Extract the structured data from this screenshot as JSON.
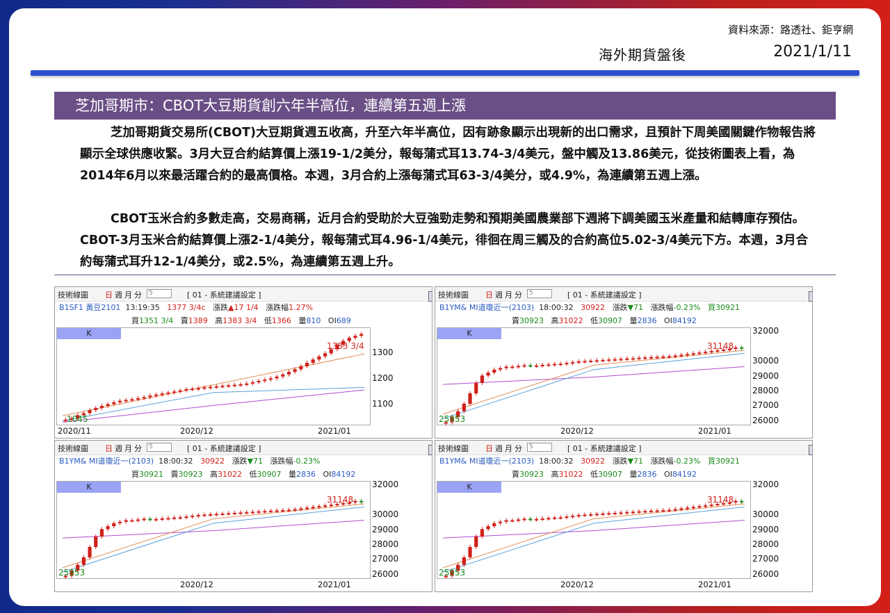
{
  "header": {
    "source": "資料來源：路透社、鉅亨網",
    "section": "海外期貨盤後",
    "date": "2021/1/11"
  },
  "article": {
    "title": "芝加哥期市：CBOT大豆期貨創六年半高位，連續第五週上漲",
    "paragraphs": [
      "芝加哥期貨交易所(CBOT)大豆期貨週五收高，升至六年半高位，因有跡象顯示出現新的出口需求，且預計下周美國關鍵作物報告將顯示全球供應收緊。3月大豆合約結算價上漲19-1/2美分，報每蒲式耳13.74-3/4美元，盤中觸及13.86美元，從技術圖表上看，為2014年6月以來最活躍合約的最高價格。本週，3月合約上漲每蒲式耳63-3/4美分，或4.9%，為連續第五週上漲。",
      "CBOT玉米合約多數走高，交易商稱，近月合約受助於大豆強勁走勢和預期美國農業部下週將下調美國玉米產量和結轉庫存預估。CBOT-3月玉米合約結算價上漲2-1/4美分，報每蒲式耳4.96-1/4美元，徘徊在周三觸及的合約高位5.02-3/4美元下方。本週，3月合約每蒲式耳升12-1/4美分，或2.5%，為連續第五週上升。"
    ]
  },
  "toolbar": {
    "label": "技術線圖",
    "day": "日",
    "week": "週",
    "month": "月",
    "minute": "分",
    "period": "5",
    "setting": "[ 01 - 系統建議設定 ]",
    "k_label": "K"
  },
  "chart_data": [
    {
      "type": "candlestick",
      "symbol": "B1SF1 黃豆2101",
      "time": "13:19:35",
      "last": "1377 3/4c",
      "change_label": "漲跌",
      "change": "▲17 1/4",
      "pct_label": "漲跌幅",
      "pct": "1.27%",
      "quote_extra": "",
      "stats": [
        {
          "label": "買",
          "value": "1351 3/4",
          "tone": "green"
        },
        {
          "label": "賣",
          "value": "1389",
          "tone": "red"
        },
        {
          "label": "高",
          "value": "1383 3/4",
          "tone": "red"
        },
        {
          "label": "低",
          "value": "1366",
          "tone": "red"
        },
        {
          "label": "量",
          "value": "810",
          "tone": "blue"
        },
        {
          "label": "OI",
          "value": "689",
          "tone": "blue"
        }
      ],
      "yticks": [
        1300,
        1200,
        1100
      ],
      "ylim": [
        1020,
        1400
      ],
      "high_label": "1383 3/4",
      "low_label": "1045",
      "x_labels": [
        "2020/11",
        "2020/12",
        "2021/01"
      ],
      "closes": [
        1045,
        1050,
        1062,
        1070,
        1082,
        1090,
        1098,
        1105,
        1112,
        1118,
        1121,
        1124,
        1128,
        1132,
        1138,
        1142,
        1146,
        1150,
        1154,
        1158,
        1163,
        1165,
        1167,
        1170,
        1172,
        1174,
        1176,
        1178,
        1180,
        1182,
        1185,
        1190,
        1195,
        1200,
        1205,
        1212,
        1220,
        1230,
        1240,
        1252,
        1265,
        1278,
        1290,
        1302,
        1318,
        1335,
        1350,
        1362,
        1370,
        1377
      ],
      "ma_short": [
        1060,
        1180,
        1300
      ],
      "ma_long": [
        1040,
        1150,
        1170
      ],
      "ma_slow": [
        1035,
        1100,
        1160
      ]
    },
    {
      "type": "candlestick",
      "symbol": "B1YM& MI道瓊近一(2103)",
      "time": "18:00:32",
      "last": "30922",
      "change_label": "漲跌",
      "change": "▼71",
      "pct_label": "漲跌幅",
      "pct": "-0.23%",
      "quote_extra": "買30921",
      "stats": [
        {
          "label": "賣",
          "value": "30923",
          "tone": "green"
        },
        {
          "label": "高",
          "value": "31022",
          "tone": "red"
        },
        {
          "label": "低",
          "value": "30907",
          "tone": "green"
        },
        {
          "label": "量",
          "value": "2836",
          "tone": "blue"
        },
        {
          "label": "OI",
          "value": "84192",
          "tone": "blue"
        }
      ],
      "yticks": [
        32000,
        30000,
        29000,
        28000,
        27000,
        26000
      ],
      "ylim": [
        25700,
        32300
      ],
      "high_label": "31148",
      "low_label": "25953",
      "x_labels": [
        "",
        "2020/12",
        "2021/01"
      ],
      "closes": [
        25953,
        26300,
        26700,
        27200,
        27900,
        28600,
        29100,
        29300,
        29500,
        29600,
        29700,
        29700,
        29750,
        29800,
        29750,
        29780,
        29820,
        29850,
        29880,
        29900,
        29950,
        30000,
        30050,
        30080,
        30100,
        30130,
        30150,
        30180,
        30200,
        30220,
        30250,
        30270,
        30300,
        30320,
        30340,
        30360,
        30380,
        30400,
        30450,
        30500,
        30550,
        30600,
        30650,
        30700,
        30750,
        30800,
        30850,
        30900,
        31000,
        30922
      ],
      "ma_short": [
        26500,
        29800,
        30800
      ],
      "ma_long": [
        26200,
        29500,
        30600
      ],
      "ma_slow": [
        28500,
        29000,
        29700
      ]
    },
    {
      "type": "candlestick",
      "symbol": "B1YM& MI道瓊近一(2103)",
      "time": "18:00:32",
      "last": "30922",
      "change_label": "漲跌",
      "change": "▼71",
      "pct_label": "漲跌幅",
      "pct": "-0.23%",
      "quote_extra": "",
      "stats": [
        {
          "label": "買",
          "value": "30921",
          "tone": "green"
        },
        {
          "label": "賣",
          "value": "30923",
          "tone": "green"
        },
        {
          "label": "高",
          "value": "31022",
          "tone": "red"
        },
        {
          "label": "低",
          "value": "30907",
          "tone": "green"
        },
        {
          "label": "量",
          "value": "2836",
          "tone": "blue"
        },
        {
          "label": "OI",
          "value": "84192",
          "tone": "blue"
        }
      ],
      "yticks": [
        32000,
        30000,
        29000,
        28000,
        27000,
        26000
      ],
      "ylim": [
        25700,
        32300
      ],
      "high_label": "31148",
      "low_label": "25953",
      "x_labels": [
        "",
        "2020/12",
        "2021/01"
      ],
      "closes": [
        25953,
        26300,
        26700,
        27200,
        27900,
        28600,
        29100,
        29300,
        29500,
        29600,
        29700,
        29700,
        29750,
        29800,
        29750,
        29780,
        29820,
        29850,
        29880,
        29900,
        29950,
        30000,
        30050,
        30080,
        30100,
        30130,
        30150,
        30180,
        30200,
        30220,
        30250,
        30270,
        30300,
        30320,
        30340,
        30360,
        30380,
        30400,
        30450,
        30500,
        30550,
        30600,
        30650,
        30700,
        30750,
        30800,
        30850,
        30900,
        31000,
        30922
      ],
      "ma_short": [
        26500,
        29800,
        30800
      ],
      "ma_long": [
        26200,
        29500,
        30600
      ],
      "ma_slow": [
        28500,
        29000,
        29700
      ]
    },
    {
      "type": "candlestick",
      "symbol": "B1YM& MI道瓊近一(2103)",
      "time": "18:00:32",
      "last": "30922",
      "change_label": "漲跌",
      "change": "▼71",
      "pct_label": "漲跌幅",
      "pct": "-0.23%",
      "quote_extra": "買30921",
      "stats": [
        {
          "label": "賣",
          "value": "30923",
          "tone": "green"
        },
        {
          "label": "高",
          "value": "31022",
          "tone": "red"
        },
        {
          "label": "低",
          "value": "30907",
          "tone": "green"
        },
        {
          "label": "量",
          "value": "2836",
          "tone": "blue"
        },
        {
          "label": "OI",
          "value": "84192",
          "tone": "blue"
        }
      ],
      "yticks": [
        32000,
        30000,
        29000,
        28000,
        27000,
        26000
      ],
      "ylim": [
        25700,
        32300
      ],
      "high_label": "31148",
      "low_label": "25953",
      "x_labels": [
        "",
        "2020/12",
        "2021/01"
      ],
      "closes": [
        25953,
        26300,
        26700,
        27200,
        27900,
        28600,
        29100,
        29300,
        29500,
        29600,
        29700,
        29700,
        29750,
        29800,
        29750,
        29780,
        29820,
        29850,
        29880,
        29900,
        29950,
        30000,
        30050,
        30080,
        30100,
        30130,
        30150,
        30180,
        30200,
        30220,
        30250,
        30270,
        30300,
        30320,
        30340,
        30360,
        30380,
        30400,
        30450,
        30500,
        30550,
        30600,
        30650,
        30700,
        30750,
        30800,
        30850,
        30900,
        31000,
        30922
      ],
      "ma_short": [
        26500,
        29800,
        30800
      ],
      "ma_long": [
        26200,
        29500,
        30600
      ],
      "ma_slow": [
        28500,
        29000,
        29700
      ]
    }
  ]
}
